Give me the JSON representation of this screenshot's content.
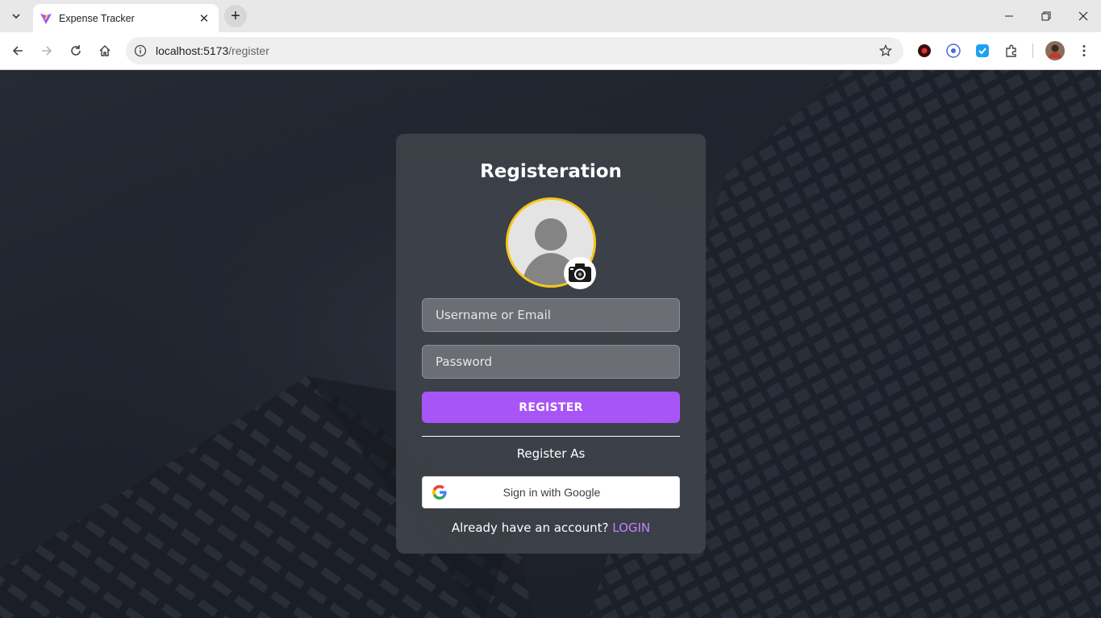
{
  "browser": {
    "tab_title": "Expense Tracker",
    "url_host": "localhost:5173",
    "url_path": "/register"
  },
  "register": {
    "title": "Registeration",
    "username_placeholder": "Username or Email",
    "password_placeholder": "Password",
    "register_button": "REGISTER",
    "register_as": "Register As",
    "google_button": "Sign in with Google",
    "login_prompt": "Already have an account?",
    "login_link": "LOGIN"
  },
  "icons": {
    "avatar": "default-user-avatar-icon",
    "camera": "camera-icon",
    "google": "google-logo-icon"
  },
  "colors": {
    "accent": "#a855f7",
    "link": "#c084fc",
    "avatar_ring": "#f5c518"
  }
}
